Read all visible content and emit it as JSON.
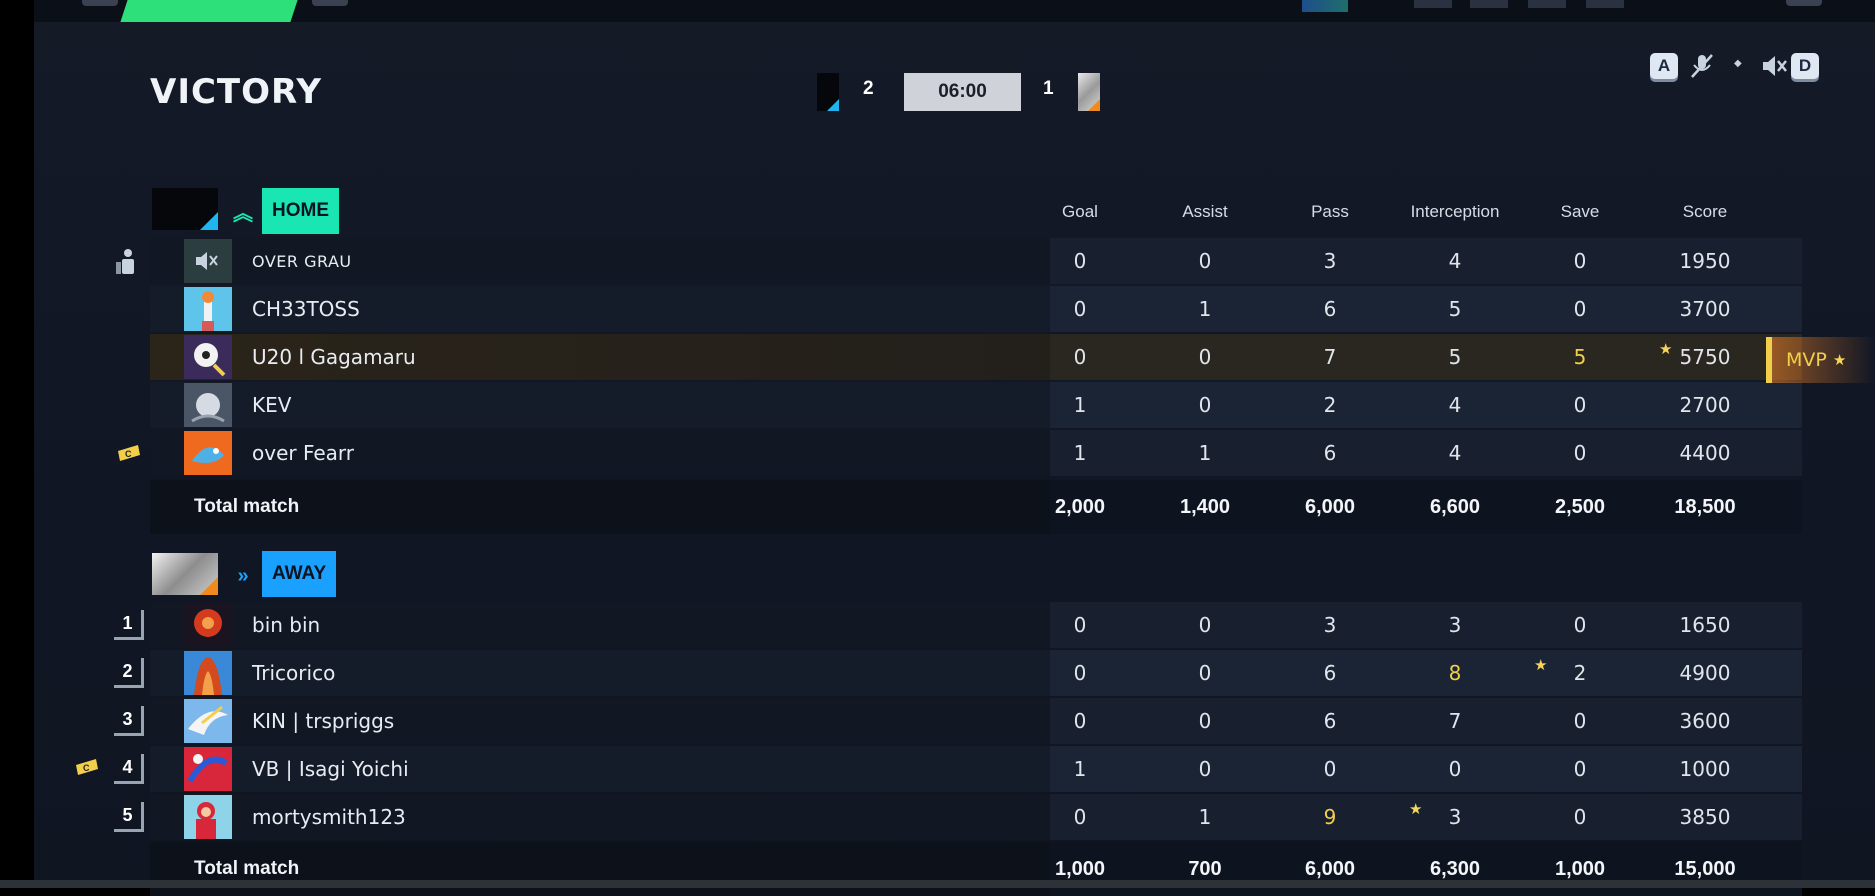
{
  "header": {
    "title": "VICTORY",
    "home_score": "2",
    "away_score": "1",
    "timer": "06:00"
  },
  "controls": {
    "key_left": "A",
    "key_right": "D",
    "icons": [
      "mic-off-icon",
      "speaker-muted-icon"
    ]
  },
  "columns": [
    "Goal",
    "Assist",
    "Pass",
    "Interception",
    "Save",
    "Score"
  ],
  "home": {
    "tag": "HOME",
    "players": [
      {
        "name": "OVER GRAU",
        "stats": [
          "0",
          "0",
          "3",
          "4",
          "0",
          "1950"
        ]
      },
      {
        "name": "CH33TOSS",
        "stats": [
          "0",
          "1",
          "6",
          "5",
          "0",
          "3700"
        ]
      },
      {
        "name": "U20 l Gagamaru",
        "stats": [
          "0",
          "0",
          "7",
          "5",
          "5",
          "5750"
        ]
      },
      {
        "name": "KEV",
        "stats": [
          "1",
          "0",
          "2",
          "4",
          "0",
          "2700"
        ]
      },
      {
        "name": "over Fearr",
        "stats": [
          "1",
          "1",
          "6",
          "4",
          "0",
          "4400"
        ]
      }
    ],
    "total_label": "Total match",
    "totals": [
      "2,000",
      "1,400",
      "6,000",
      "6,600",
      "2,500",
      "18,500"
    ]
  },
  "away": {
    "tag": "AWAY",
    "players": [
      {
        "rank": "1",
        "name": "bin bin",
        "stats": [
          "0",
          "0",
          "3",
          "3",
          "0",
          "1650"
        ]
      },
      {
        "rank": "2",
        "name": "Tricorico",
        "stats": [
          "0",
          "0",
          "6",
          "8",
          "2",
          "4900"
        ]
      },
      {
        "rank": "3",
        "name": "KIN | trspriggs",
        "stats": [
          "0",
          "0",
          "6",
          "7",
          "0",
          "3600"
        ]
      },
      {
        "rank": "4",
        "name": "VB | Isagi Yoichi",
        "stats": [
          "1",
          "0",
          "0",
          "0",
          "0",
          "1000"
        ]
      },
      {
        "rank": "5",
        "name": "mortysmith123",
        "stats": [
          "0",
          "1",
          "9",
          "3",
          "0",
          "3850"
        ]
      }
    ],
    "total_label": "Total match",
    "totals": [
      "1,000",
      "700",
      "6,000",
      "6,300",
      "1,000",
      "15,000"
    ]
  },
  "mvp": {
    "label": "MVP"
  },
  "colors": {
    "home": "#19e6b2",
    "away": "#1aa0ff",
    "highlight": "#f2cf4a",
    "selection": "#e0b933"
  }
}
